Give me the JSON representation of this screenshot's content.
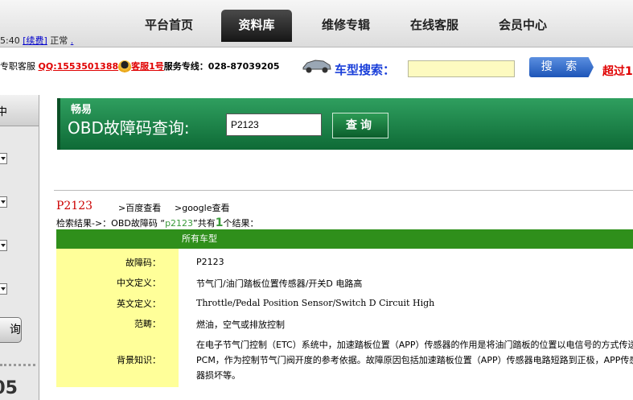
{
  "nav": {
    "items": [
      "平台首页",
      "资料库",
      "维修专辑",
      "在线客服",
      "会员中心"
    ],
    "active_index": 1
  },
  "status": {
    "time": "5:40",
    "renew_link": "[续费]",
    "state": "正常",
    "dot": "."
  },
  "service": {
    "label": "专职客服",
    "qq": "QQ:1553501388",
    "kefu": "客服1号",
    "hotline": "服务专线：028-87039205"
  },
  "car_search": {
    "label": "车型搜索：",
    "button": "搜 索",
    "promo": "超过1"
  },
  "sidebar": {
    "head": "中",
    "query_button": "询",
    "number": "05"
  },
  "obd": {
    "brand": "畅易",
    "title": "OBD故障码查询:",
    "input_value": "P2123",
    "query_button": "查询"
  },
  "result": {
    "code": "P2123",
    "baidu": ">百度查看",
    "google": ">google查看",
    "summary_prefix": "检索结果->：OBD故障码  “",
    "summary_code": "p2123",
    "summary_mid": "”共有",
    "summary_count": "1",
    "summary_suffix": "个结果："
  },
  "table": {
    "header": "所有车型",
    "rows": [
      {
        "label": "故障码：",
        "value": "P2123"
      },
      {
        "label": "中文定义：",
        "value": "节气门/油门踏板位置传感器/开关D 电路高"
      },
      {
        "label": "英文定义：",
        "value": "Throttle/Pedal Position Sensor/Switch D Circuit High"
      },
      {
        "label": "范畴：",
        "value": "燃油，空气或排放控制"
      },
      {
        "label": "背景知识：",
        "value": "在电子节气门控制（ETC）系统中，加速踏板位置（APP）传感器的作用是将油门踏板的位置以电信号的方式传送给PCM，作为控制节气门阀开度的参考依据。故障原因包括加速踏板位置（APP）传感器电路短路到正极，APP传感器损坏等。"
      }
    ]
  },
  "colors": {
    "banner_green": "#1a7d44",
    "table_header_green": "#2f8f1b",
    "label_yellow": "#ffff99",
    "code_red": "#cc0000"
  }
}
